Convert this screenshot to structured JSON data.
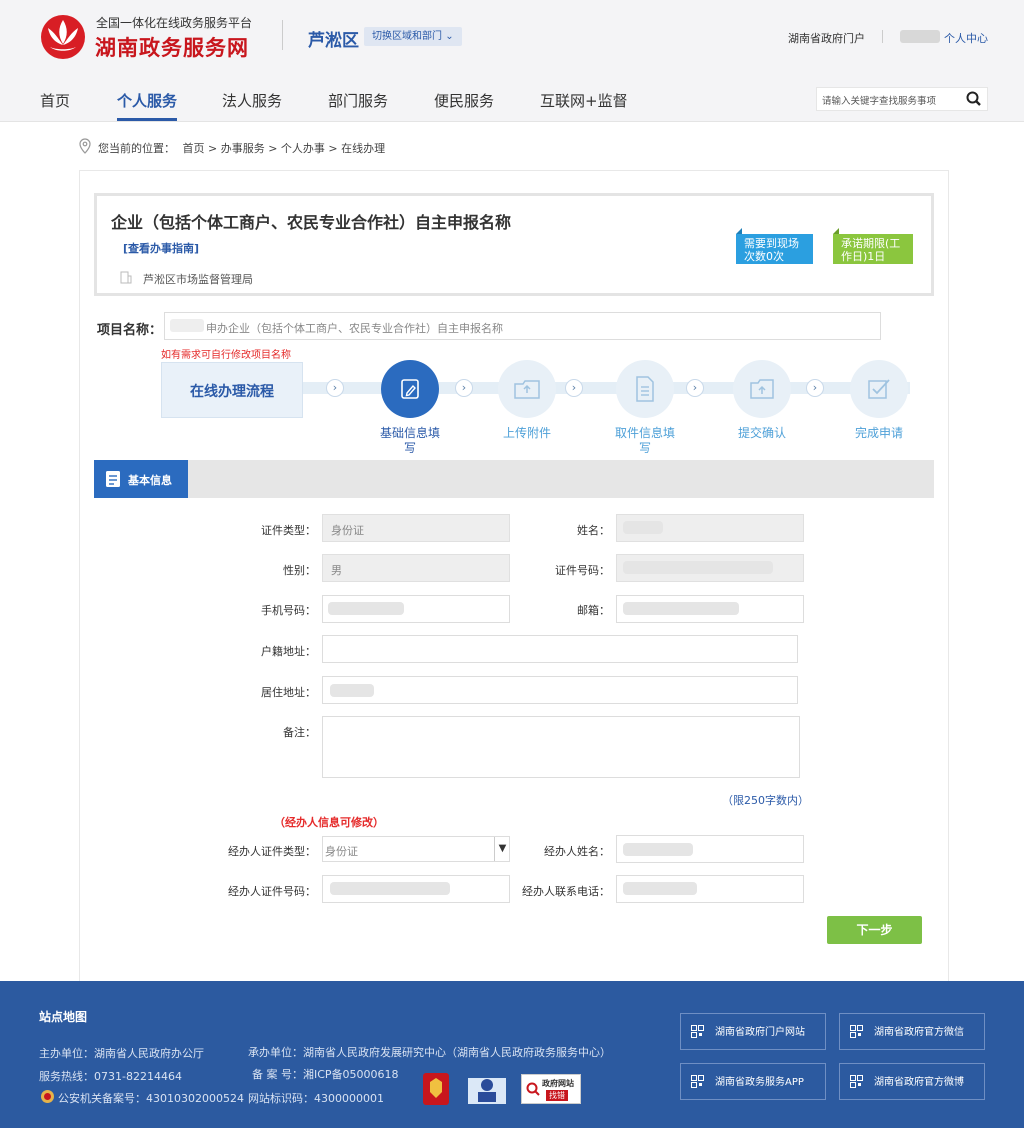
{
  "header": {
    "platform_subtitle": "全国一体化在线政务服务平台",
    "site_title": "湖南政务服务网",
    "region": "芦淞区",
    "switch_region": "切换区域和部门",
    "portal_link": "湖南省政府门户",
    "user_center": "个人中心"
  },
  "nav": {
    "items": [
      "首页",
      "个人服务",
      "法人服务",
      "部门服务",
      "便民服务",
      "互联网+监督"
    ],
    "active": "个人服务",
    "search_placeholder": "请输入关键字查找服务事项"
  },
  "breadcrumb": {
    "label": "您当前的位置：",
    "path": "首页  >  办事服务  >  个人办事  >  在线办理"
  },
  "item": {
    "title": "企业（包括个体工商户、农民专业合作社）自主申报名称",
    "guide_link": "[查看办事指南]",
    "department": "芦淞区市场监督管理局",
    "tag_visits": "需要到现场\n次数0次",
    "tag_visits_l1": "需要到现场",
    "tag_visits_l2": "次数0次",
    "tag_deadline_l1": "承诺期限(工",
    "tag_deadline_l2": "作日)1日",
    "tag_colors": {
      "visits": "#2b9fe0",
      "deadline": "#8bc63e"
    }
  },
  "project": {
    "label": "项目名称：",
    "value": "申办企业（包括个体工商户、农民专业合作社）自主申报名称",
    "hint": "如有需求可自行修改项目名称"
  },
  "flow": {
    "label": "在线办理流程",
    "steps": [
      {
        "label": "基础信息填写",
        "icon": "edit-icon",
        "active": true
      },
      {
        "label": "上传附件",
        "icon": "upload-folder-icon",
        "active": false
      },
      {
        "label": "取件信息填写",
        "icon": "document-icon",
        "active": false
      },
      {
        "label": "提交确认",
        "icon": "submit-folder-icon",
        "active": false
      },
      {
        "label": "完成申请",
        "icon": "checkbox-icon",
        "active": false
      }
    ]
  },
  "section": {
    "title": "基本信息"
  },
  "form": {
    "id_type_label": "证件类型：",
    "id_type_value": "身份证",
    "name_label": "姓名：",
    "gender_label": "性别：",
    "gender_value": "男",
    "id_number_label": "证件号码：",
    "phone_label": "手机号码：",
    "email_label": "邮箱：",
    "household_label": "户籍地址：",
    "residence_label": "居住地址：",
    "remark_label": "备注：",
    "remark_limit": "（限250字数内）",
    "agent_hint": "（经办人信息可修改）",
    "agent_id_type_label": "经办人证件类型：",
    "agent_id_type_value": "身份证",
    "agent_name_label": "经办人姓名：",
    "agent_id_number_label": "经办人证件号码：",
    "agent_phone_label": "经办人联系电话：",
    "next_button": "下一步"
  },
  "footer": {
    "title": "站点地图",
    "host": "主办单位：湖南省人民政府办公厅",
    "organizer": "承办单位：湖南省人民政府发展研究中心（湖南省人民政府政务服务中心）",
    "hotline": "服务热线：0731-82214464",
    "icp": "备 案 号：湘ICP备05000618",
    "police": "公安机关备案号：43010302000524",
    "site_id": "网站标识码：4300000001",
    "error_badge_l1": "政府网站",
    "error_badge_l2": "找错",
    "links": [
      "湖南省政府门户网站",
      "湖南省政府官方微信",
      "湖南省政务服务APP",
      "湖南省政府官方微博"
    ]
  },
  "colors": {
    "primary": "#2b5aa8",
    "brand_red": "#c8161d",
    "next_green": "#7dc046",
    "footer_bg": "#2c5aa0",
    "hint_red": "#e52a2a"
  }
}
